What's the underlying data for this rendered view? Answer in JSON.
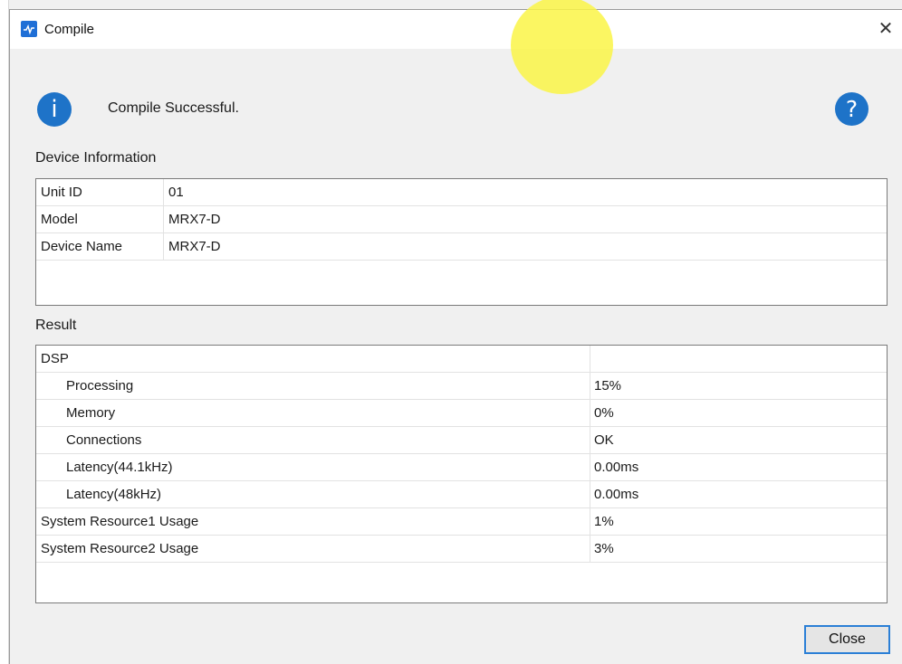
{
  "window": {
    "title": "Compile"
  },
  "message": "Compile Successful.",
  "device_info": {
    "label": "Device Information",
    "rows": [
      {
        "key": "Unit ID",
        "value": "01"
      },
      {
        "key": "Model",
        "value": "MRX7-D"
      },
      {
        "key": "Device Name",
        "value": "MRX7-D"
      }
    ]
  },
  "result": {
    "label": "Result",
    "rows": [
      {
        "key": "DSP",
        "value": ""
      },
      {
        "key": "Processing",
        "value": "15%"
      },
      {
        "key": "Memory",
        "value": "0%"
      },
      {
        "key": "Connections",
        "value": "OK"
      },
      {
        "key": "Latency(44.1kHz)",
        "value": "0.00ms"
      },
      {
        "key": "Latency(48kHz)",
        "value": "0.00ms"
      },
      {
        "key": "System Resource1 Usage",
        "value": "1%"
      },
      {
        "key": "System Resource2 Usage",
        "value": "3%"
      }
    ]
  },
  "buttons": {
    "close": "Close"
  },
  "icons": {
    "info": "info-icon",
    "help": "help-icon",
    "close": "close-icon",
    "app": "app-icon"
  },
  "colors": {
    "accent": "#1e73c8",
    "focus": "#2b7fd6",
    "highlight": "#faf546"
  }
}
